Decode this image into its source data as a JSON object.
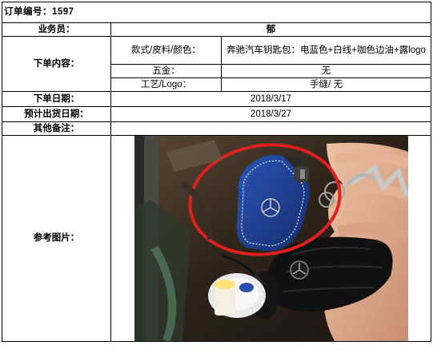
{
  "order": {
    "title_label": "订单编号：",
    "title_number": "1597"
  },
  "rows": {
    "agent_label": "业务员：",
    "agent_value": "郁",
    "content_label": "下单内容：",
    "style_label": "款式/皮料/颜色：",
    "style_value": "奔驰汽车钥匙包：电蓝色+白线+咖色边油+露logo",
    "hardware_label": "五金：",
    "hardware_value": "无",
    "craft_label": "工艺/Logo：",
    "craft_value": "手缝/ 无",
    "order_date_label": "下单日期：",
    "order_date_value": "2018/3/17",
    "ship_date_label": "预计出货日期：",
    "ship_date_value": "2018/3/27",
    "remarks_label": "其他备注：",
    "remarks_value": "",
    "ref_image_label": "参考图片："
  },
  "colors": {
    "leather_blue": "#1d3f8f",
    "circle_red": "#e0201e",
    "stitch_white": "#f2f2f2"
  }
}
